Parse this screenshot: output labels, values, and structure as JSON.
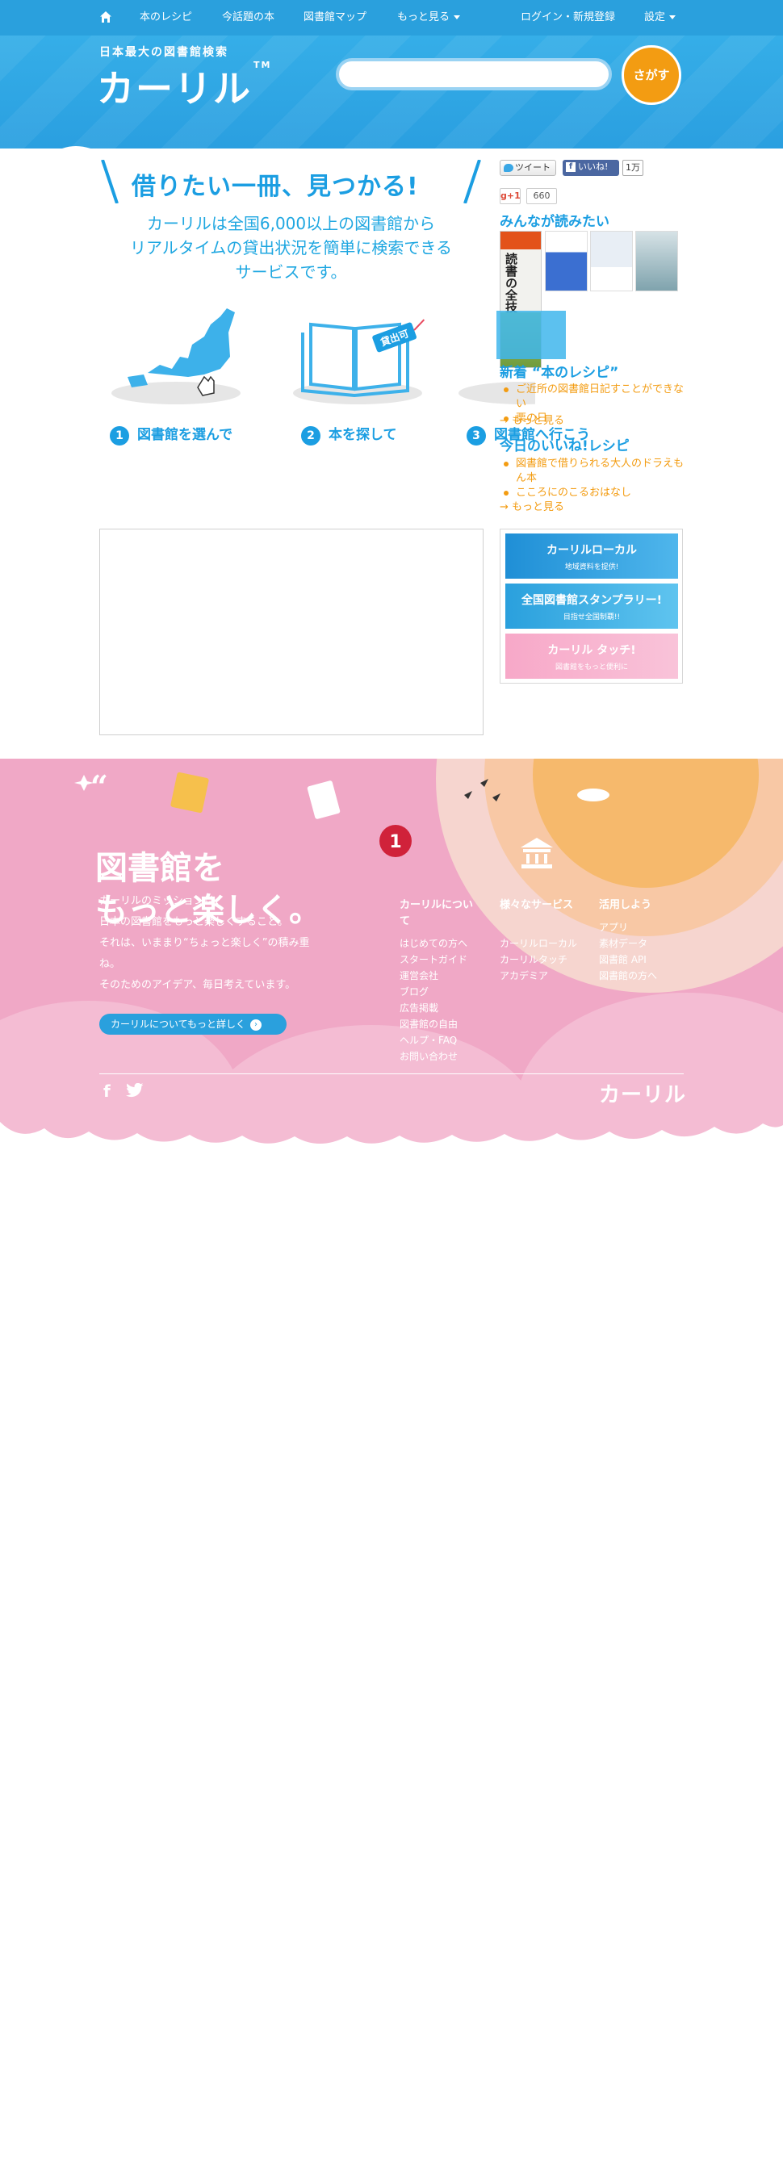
{
  "nav": {
    "items": [
      {
        "label": "本のレシピ"
      },
      {
        "label": "今話題の本"
      },
      {
        "label": "図書館マップ"
      },
      {
        "label": "もっと見る"
      },
      {
        "label": "ログイン・新規登録"
      },
      {
        "label": "設定"
      }
    ],
    "home_icon": "home-icon"
  },
  "header": {
    "tagline": "日本最大の図書館検索",
    "logo": "カーリル",
    "logo_tm": "TM",
    "search_placeholder": "",
    "search_button": "さがす"
  },
  "hero": {
    "title": "借りたい一冊、見つかる!",
    "lead_1": "カーリルは全国6,000以上の図書館から",
    "lead_2": "リアルタイムの貸出状況を簡単に検索できる",
    "lead_3": "サービスです。",
    "steps": [
      {
        "num": "1",
        "label": "図書館を選んで"
      },
      {
        "num": "2",
        "label": "本を探して"
      },
      {
        "num": "3",
        "label": "図書館へ行こう"
      }
    ],
    "badge": "貸出可"
  },
  "social": {
    "tweet": "ツイート",
    "like": "いいね!",
    "like_count": "1万",
    "gplus": "g+1",
    "gplus_count": "660"
  },
  "sidebar": {
    "popular_heading": "みんなが読みたい",
    "book_1_title": "読書の全技術",
    "new_recipes_heading": "新着 “本のレシピ”",
    "new_recipes": [
      "ご近所の図書館日記すことができない",
      "栗の日"
    ],
    "more_1": "→ もっと見る",
    "liked_heading": "今日のいいね!レシピ",
    "liked_recipes": [
      "図書館で借りられる大人のドラえもん本",
      "こころにのこるおはなし"
    ],
    "more_2": "→ もっと見る",
    "banners": [
      {
        "title": "カーリルローカル",
        "sub": "地域資料を提供!"
      },
      {
        "title": "全国図書館スタンプラリー!",
        "sub": "目指せ全国制覇!!"
      },
      {
        "title": "カーリル タッチ!",
        "sub": "図書館をもっと便利に"
      }
    ]
  },
  "footer": {
    "title_1": "図書館を",
    "title_2": "もっと楽しく。",
    "mission": [
      "カーリルのミッションは、",
      "日本の図書館をもっと楽しくすること。",
      "それは、いままり“ちょっと楽しく”の積み重",
      "ね。",
      "そのためのアイデア、毎日考えています。"
    ],
    "mission_button": "カーリルについてもっと詳しく",
    "columns": [
      {
        "title": "カーリルについて",
        "links": [
          "はじめての方へ",
          "スタートガイド",
          "運営会社",
          "ブログ",
          "広告掲載",
          "図書館の自由",
          "ヘルプ・FAQ",
          "お問い合わせ"
        ]
      },
      {
        "title": "様々なサービス",
        "links": [
          "カーリルローカル",
          "カーリルタッチ",
          "アカデミア"
        ]
      },
      {
        "title": "活用しよう",
        "links": [
          "アプリ",
          "素材データ",
          "図書館 API",
          "図書館の方へ"
        ]
      }
    ],
    "logo": "カーリル",
    "stamp_num": "1"
  },
  "colors": {
    "brand_blue": "#2aa0dd",
    "accent_orange": "#f39c12",
    "footer_pink": "#f0a8c6"
  }
}
